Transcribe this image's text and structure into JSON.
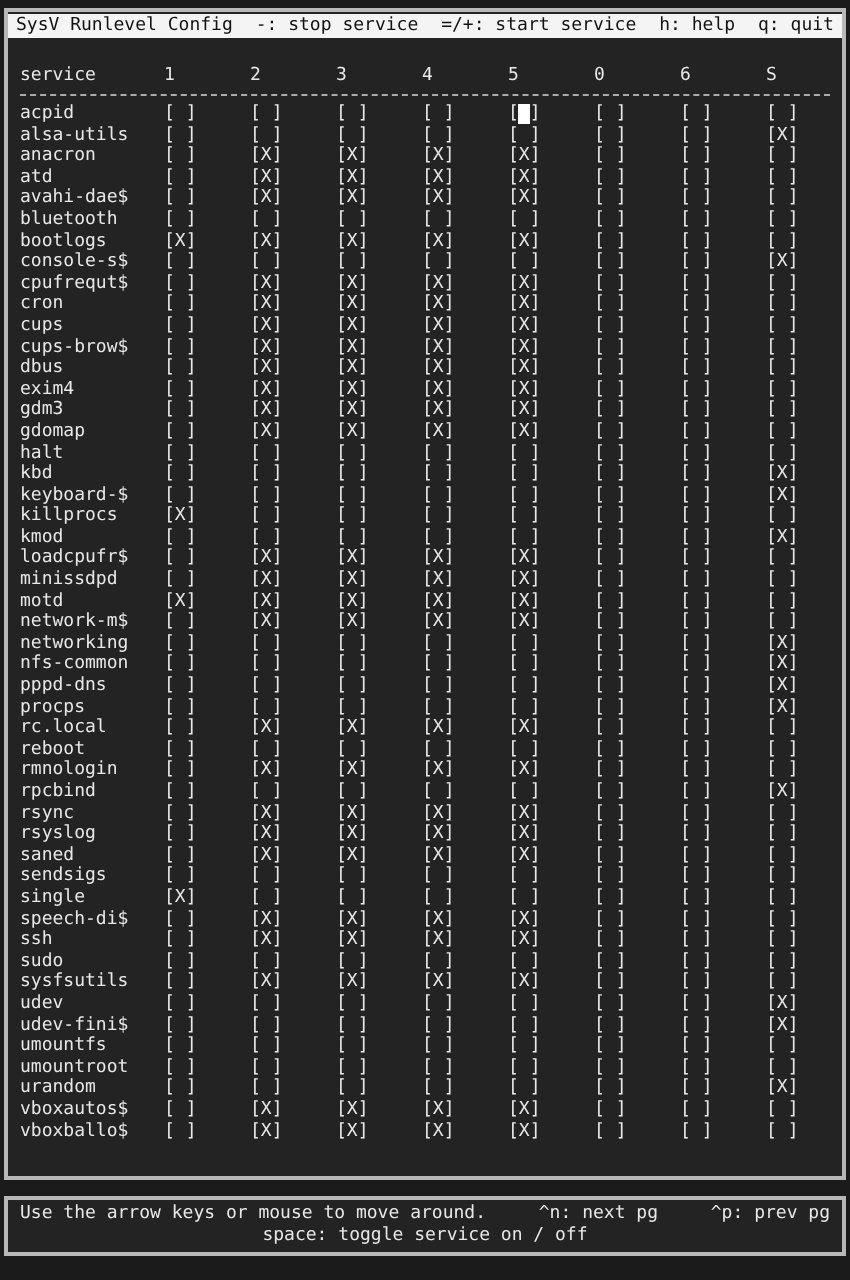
{
  "title_bar": {
    "title": "SysV Runlevel Config",
    "hints": [
      "-: stop service",
      "=/+: start service",
      "h: help",
      "q: quit"
    ]
  },
  "table": {
    "first_column": "service",
    "columns": [
      "1",
      "2",
      "3",
      "4",
      "5",
      "0",
      "6",
      "S"
    ],
    "rows": [
      {
        "service": "acpid",
        "cells": [
          {
            "text": "[ ]",
            "selected": false
          },
          {
            "text": "[ ]",
            "selected": false
          },
          {
            "text": "[ ]",
            "selected": false
          },
          {
            "text": "[ ]",
            "selected": false
          },
          {
            "text": "[ ]",
            "selected": true
          },
          {
            "text": "[ ]",
            "selected": false
          },
          {
            "text": "[ ]",
            "selected": false
          },
          {
            "text": "[ ]",
            "selected": false
          }
        ]
      },
      {
        "service": "alsa-utils",
        "cells": [
          {
            "text": "[ ]",
            "selected": false
          },
          {
            "text": "[ ]",
            "selected": false
          },
          {
            "text": "[ ]",
            "selected": false
          },
          {
            "text": "[ ]",
            "selected": false
          },
          {
            "text": "[ ]",
            "selected": false
          },
          {
            "text": "[ ]",
            "selected": false
          },
          {
            "text": "[ ]",
            "selected": false
          },
          {
            "text": "[X]",
            "selected": false
          }
        ]
      },
      {
        "service": "anacron",
        "cells": [
          {
            "text": "[ ]",
            "selected": false
          },
          {
            "text": "[X]",
            "selected": false
          },
          {
            "text": "[X]",
            "selected": false
          },
          {
            "text": "[X]",
            "selected": false
          },
          {
            "text": "[X]",
            "selected": false
          },
          {
            "text": "[ ]",
            "selected": false
          },
          {
            "text": "[ ]",
            "selected": false
          },
          {
            "text": "[ ]",
            "selected": false
          }
        ]
      },
      {
        "service": "atd",
        "cells": [
          {
            "text": "[ ]",
            "selected": false
          },
          {
            "text": "[X]",
            "selected": false
          },
          {
            "text": "[X]",
            "selected": false
          },
          {
            "text": "[X]",
            "selected": false
          },
          {
            "text": "[X]",
            "selected": false
          },
          {
            "text": "[ ]",
            "selected": false
          },
          {
            "text": "[ ]",
            "selected": false
          },
          {
            "text": "[ ]",
            "selected": false
          }
        ]
      },
      {
        "service": "avahi-dae$",
        "cells": [
          {
            "text": "[ ]",
            "selected": false
          },
          {
            "text": "[X]",
            "selected": false
          },
          {
            "text": "[X]",
            "selected": false
          },
          {
            "text": "[X]",
            "selected": false
          },
          {
            "text": "[X]",
            "selected": false
          },
          {
            "text": "[ ]",
            "selected": false
          },
          {
            "text": "[ ]",
            "selected": false
          },
          {
            "text": "[ ]",
            "selected": false
          }
        ]
      },
      {
        "service": "bluetooth",
        "cells": [
          {
            "text": "[ ]",
            "selected": false
          },
          {
            "text": "[ ]",
            "selected": false
          },
          {
            "text": "[ ]",
            "selected": false
          },
          {
            "text": "[ ]",
            "selected": false
          },
          {
            "text": "[ ]",
            "selected": false
          },
          {
            "text": "[ ]",
            "selected": false
          },
          {
            "text": "[ ]",
            "selected": false
          },
          {
            "text": "[ ]",
            "selected": false
          }
        ]
      },
      {
        "service": "bootlogs",
        "cells": [
          {
            "text": "[X]",
            "selected": false
          },
          {
            "text": "[X]",
            "selected": false
          },
          {
            "text": "[X]",
            "selected": false
          },
          {
            "text": "[X]",
            "selected": false
          },
          {
            "text": "[X]",
            "selected": false
          },
          {
            "text": "[ ]",
            "selected": false
          },
          {
            "text": "[ ]",
            "selected": false
          },
          {
            "text": "[ ]",
            "selected": false
          }
        ]
      },
      {
        "service": "console-s$",
        "cells": [
          {
            "text": "[ ]",
            "selected": false
          },
          {
            "text": "[ ]",
            "selected": false
          },
          {
            "text": "[ ]",
            "selected": false
          },
          {
            "text": "[ ]",
            "selected": false
          },
          {
            "text": "[ ]",
            "selected": false
          },
          {
            "text": "[ ]",
            "selected": false
          },
          {
            "text": "[ ]",
            "selected": false
          },
          {
            "text": "[X]",
            "selected": false
          }
        ]
      },
      {
        "service": "cpufrequt$",
        "cells": [
          {
            "text": "[ ]",
            "selected": false
          },
          {
            "text": "[X]",
            "selected": false
          },
          {
            "text": "[X]",
            "selected": false
          },
          {
            "text": "[X]",
            "selected": false
          },
          {
            "text": "[X]",
            "selected": false
          },
          {
            "text": "[ ]",
            "selected": false
          },
          {
            "text": "[ ]",
            "selected": false
          },
          {
            "text": "[ ]",
            "selected": false
          }
        ]
      },
      {
        "service": "cron",
        "cells": [
          {
            "text": "[ ]",
            "selected": false
          },
          {
            "text": "[X]",
            "selected": false
          },
          {
            "text": "[X]",
            "selected": false
          },
          {
            "text": "[X]",
            "selected": false
          },
          {
            "text": "[X]",
            "selected": false
          },
          {
            "text": "[ ]",
            "selected": false
          },
          {
            "text": "[ ]",
            "selected": false
          },
          {
            "text": "[ ]",
            "selected": false
          }
        ]
      },
      {
        "service": "cups",
        "cells": [
          {
            "text": "[ ]",
            "selected": false
          },
          {
            "text": "[X]",
            "selected": false
          },
          {
            "text": "[X]",
            "selected": false
          },
          {
            "text": "[X]",
            "selected": false
          },
          {
            "text": "[X]",
            "selected": false
          },
          {
            "text": "[ ]",
            "selected": false
          },
          {
            "text": "[ ]",
            "selected": false
          },
          {
            "text": "[ ]",
            "selected": false
          }
        ]
      },
      {
        "service": "cups-brow$",
        "cells": [
          {
            "text": "[ ]",
            "selected": false
          },
          {
            "text": "[X]",
            "selected": false
          },
          {
            "text": "[X]",
            "selected": false
          },
          {
            "text": "[X]",
            "selected": false
          },
          {
            "text": "[X]",
            "selected": false
          },
          {
            "text": "[ ]",
            "selected": false
          },
          {
            "text": "[ ]",
            "selected": false
          },
          {
            "text": "[ ]",
            "selected": false
          }
        ]
      },
      {
        "service": "dbus",
        "cells": [
          {
            "text": "[ ]",
            "selected": false
          },
          {
            "text": "[X]",
            "selected": false
          },
          {
            "text": "[X]",
            "selected": false
          },
          {
            "text": "[X]",
            "selected": false
          },
          {
            "text": "[X]",
            "selected": false
          },
          {
            "text": "[ ]",
            "selected": false
          },
          {
            "text": "[ ]",
            "selected": false
          },
          {
            "text": "[ ]",
            "selected": false
          }
        ]
      },
      {
        "service": "exim4",
        "cells": [
          {
            "text": "[ ]",
            "selected": false
          },
          {
            "text": "[X]",
            "selected": false
          },
          {
            "text": "[X]",
            "selected": false
          },
          {
            "text": "[X]",
            "selected": false
          },
          {
            "text": "[X]",
            "selected": false
          },
          {
            "text": "[ ]",
            "selected": false
          },
          {
            "text": "[ ]",
            "selected": false
          },
          {
            "text": "[ ]",
            "selected": false
          }
        ]
      },
      {
        "service": "gdm3",
        "cells": [
          {
            "text": "[ ]",
            "selected": false
          },
          {
            "text": "[X]",
            "selected": false
          },
          {
            "text": "[X]",
            "selected": false
          },
          {
            "text": "[X]",
            "selected": false
          },
          {
            "text": "[X]",
            "selected": false
          },
          {
            "text": "[ ]",
            "selected": false
          },
          {
            "text": "[ ]",
            "selected": false
          },
          {
            "text": "[ ]",
            "selected": false
          }
        ]
      },
      {
        "service": "gdomap",
        "cells": [
          {
            "text": "[ ]",
            "selected": false
          },
          {
            "text": "[X]",
            "selected": false
          },
          {
            "text": "[X]",
            "selected": false
          },
          {
            "text": "[X]",
            "selected": false
          },
          {
            "text": "[X]",
            "selected": false
          },
          {
            "text": "[ ]",
            "selected": false
          },
          {
            "text": "[ ]",
            "selected": false
          },
          {
            "text": "[ ]",
            "selected": false
          }
        ]
      },
      {
        "service": "halt",
        "cells": [
          {
            "text": "[ ]",
            "selected": false
          },
          {
            "text": "[ ]",
            "selected": false
          },
          {
            "text": "[ ]",
            "selected": false
          },
          {
            "text": "[ ]",
            "selected": false
          },
          {
            "text": "[ ]",
            "selected": false
          },
          {
            "text": "[ ]",
            "selected": false
          },
          {
            "text": "[ ]",
            "selected": false
          },
          {
            "text": "[ ]",
            "selected": false
          }
        ]
      },
      {
        "service": "kbd",
        "cells": [
          {
            "text": "[ ]",
            "selected": false
          },
          {
            "text": "[ ]",
            "selected": false
          },
          {
            "text": "[ ]",
            "selected": false
          },
          {
            "text": "[ ]",
            "selected": false
          },
          {
            "text": "[ ]",
            "selected": false
          },
          {
            "text": "[ ]",
            "selected": false
          },
          {
            "text": "[ ]",
            "selected": false
          },
          {
            "text": "[X]",
            "selected": false
          }
        ]
      },
      {
        "service": "keyboard-$",
        "cells": [
          {
            "text": "[ ]",
            "selected": false
          },
          {
            "text": "[ ]",
            "selected": false
          },
          {
            "text": "[ ]",
            "selected": false
          },
          {
            "text": "[ ]",
            "selected": false
          },
          {
            "text": "[ ]",
            "selected": false
          },
          {
            "text": "[ ]",
            "selected": false
          },
          {
            "text": "[ ]",
            "selected": false
          },
          {
            "text": "[X]",
            "selected": false
          }
        ]
      },
      {
        "service": "killprocs",
        "cells": [
          {
            "text": "[X]",
            "selected": false
          },
          {
            "text": "[ ]",
            "selected": false
          },
          {
            "text": "[ ]",
            "selected": false
          },
          {
            "text": "[ ]",
            "selected": false
          },
          {
            "text": "[ ]",
            "selected": false
          },
          {
            "text": "[ ]",
            "selected": false
          },
          {
            "text": "[ ]",
            "selected": false
          },
          {
            "text": "[ ]",
            "selected": false
          }
        ]
      },
      {
        "service": "kmod",
        "cells": [
          {
            "text": "[ ]",
            "selected": false
          },
          {
            "text": "[ ]",
            "selected": false
          },
          {
            "text": "[ ]",
            "selected": false
          },
          {
            "text": "[ ]",
            "selected": false
          },
          {
            "text": "[ ]",
            "selected": false
          },
          {
            "text": "[ ]",
            "selected": false
          },
          {
            "text": "[ ]",
            "selected": false
          },
          {
            "text": "[X]",
            "selected": false
          }
        ]
      },
      {
        "service": "loadcpufr$",
        "cells": [
          {
            "text": "[ ]",
            "selected": false
          },
          {
            "text": "[X]",
            "selected": false
          },
          {
            "text": "[X]",
            "selected": false
          },
          {
            "text": "[X]",
            "selected": false
          },
          {
            "text": "[X]",
            "selected": false
          },
          {
            "text": "[ ]",
            "selected": false
          },
          {
            "text": "[ ]",
            "selected": false
          },
          {
            "text": "[ ]",
            "selected": false
          }
        ]
      },
      {
        "service": "minissdpd",
        "cells": [
          {
            "text": "[ ]",
            "selected": false
          },
          {
            "text": "[X]",
            "selected": false
          },
          {
            "text": "[X]",
            "selected": false
          },
          {
            "text": "[X]",
            "selected": false
          },
          {
            "text": "[X]",
            "selected": false
          },
          {
            "text": "[ ]",
            "selected": false
          },
          {
            "text": "[ ]",
            "selected": false
          },
          {
            "text": "[ ]",
            "selected": false
          }
        ]
      },
      {
        "service": "motd",
        "cells": [
          {
            "text": "[X]",
            "selected": false
          },
          {
            "text": "[X]",
            "selected": false
          },
          {
            "text": "[X]",
            "selected": false
          },
          {
            "text": "[X]",
            "selected": false
          },
          {
            "text": "[X]",
            "selected": false
          },
          {
            "text": "[ ]",
            "selected": false
          },
          {
            "text": "[ ]",
            "selected": false
          },
          {
            "text": "[ ]",
            "selected": false
          }
        ]
      },
      {
        "service": "network-m$",
        "cells": [
          {
            "text": "[ ]",
            "selected": false
          },
          {
            "text": "[X]",
            "selected": false
          },
          {
            "text": "[X]",
            "selected": false
          },
          {
            "text": "[X]",
            "selected": false
          },
          {
            "text": "[X]",
            "selected": false
          },
          {
            "text": "[ ]",
            "selected": false
          },
          {
            "text": "[ ]",
            "selected": false
          },
          {
            "text": "[ ]",
            "selected": false
          }
        ]
      },
      {
        "service": "networking",
        "cells": [
          {
            "text": "[ ]",
            "selected": false
          },
          {
            "text": "[ ]",
            "selected": false
          },
          {
            "text": "[ ]",
            "selected": false
          },
          {
            "text": "[ ]",
            "selected": false
          },
          {
            "text": "[ ]",
            "selected": false
          },
          {
            "text": "[ ]",
            "selected": false
          },
          {
            "text": "[ ]",
            "selected": false
          },
          {
            "text": "[X]",
            "selected": false
          }
        ]
      },
      {
        "service": "nfs-common",
        "cells": [
          {
            "text": "[ ]",
            "selected": false
          },
          {
            "text": "[ ]",
            "selected": false
          },
          {
            "text": "[ ]",
            "selected": false
          },
          {
            "text": "[ ]",
            "selected": false
          },
          {
            "text": "[ ]",
            "selected": false
          },
          {
            "text": "[ ]",
            "selected": false
          },
          {
            "text": "[ ]",
            "selected": false
          },
          {
            "text": "[X]",
            "selected": false
          }
        ]
      },
      {
        "service": "pppd-dns",
        "cells": [
          {
            "text": "[ ]",
            "selected": false
          },
          {
            "text": "[ ]",
            "selected": false
          },
          {
            "text": "[ ]",
            "selected": false
          },
          {
            "text": "[ ]",
            "selected": false
          },
          {
            "text": "[ ]",
            "selected": false
          },
          {
            "text": "[ ]",
            "selected": false
          },
          {
            "text": "[ ]",
            "selected": false
          },
          {
            "text": "[X]",
            "selected": false
          }
        ]
      },
      {
        "service": "procps",
        "cells": [
          {
            "text": "[ ]",
            "selected": false
          },
          {
            "text": "[ ]",
            "selected": false
          },
          {
            "text": "[ ]",
            "selected": false
          },
          {
            "text": "[ ]",
            "selected": false
          },
          {
            "text": "[ ]",
            "selected": false
          },
          {
            "text": "[ ]",
            "selected": false
          },
          {
            "text": "[ ]",
            "selected": false
          },
          {
            "text": "[X]",
            "selected": false
          }
        ]
      },
      {
        "service": "rc.local",
        "cells": [
          {
            "text": "[ ]",
            "selected": false
          },
          {
            "text": "[X]",
            "selected": false
          },
          {
            "text": "[X]",
            "selected": false
          },
          {
            "text": "[X]",
            "selected": false
          },
          {
            "text": "[X]",
            "selected": false
          },
          {
            "text": "[ ]",
            "selected": false
          },
          {
            "text": "[ ]",
            "selected": false
          },
          {
            "text": "[ ]",
            "selected": false
          }
        ]
      },
      {
        "service": "reboot",
        "cells": [
          {
            "text": "[ ]",
            "selected": false
          },
          {
            "text": "[ ]",
            "selected": false
          },
          {
            "text": "[ ]",
            "selected": false
          },
          {
            "text": "[ ]",
            "selected": false
          },
          {
            "text": "[ ]",
            "selected": false
          },
          {
            "text": "[ ]",
            "selected": false
          },
          {
            "text": "[ ]",
            "selected": false
          },
          {
            "text": "[ ]",
            "selected": false
          }
        ]
      },
      {
        "service": "rmnologin",
        "cells": [
          {
            "text": "[ ]",
            "selected": false
          },
          {
            "text": "[X]",
            "selected": false
          },
          {
            "text": "[X]",
            "selected": false
          },
          {
            "text": "[X]",
            "selected": false
          },
          {
            "text": "[X]",
            "selected": false
          },
          {
            "text": "[ ]",
            "selected": false
          },
          {
            "text": "[ ]",
            "selected": false
          },
          {
            "text": "[ ]",
            "selected": false
          }
        ]
      },
      {
        "service": "rpcbind",
        "cells": [
          {
            "text": "[ ]",
            "selected": false
          },
          {
            "text": "[ ]",
            "selected": false
          },
          {
            "text": "[ ]",
            "selected": false
          },
          {
            "text": "[ ]",
            "selected": false
          },
          {
            "text": "[ ]",
            "selected": false
          },
          {
            "text": "[ ]",
            "selected": false
          },
          {
            "text": "[ ]",
            "selected": false
          },
          {
            "text": "[X]",
            "selected": false
          }
        ]
      },
      {
        "service": "rsync",
        "cells": [
          {
            "text": "[ ]",
            "selected": false
          },
          {
            "text": "[X]",
            "selected": false
          },
          {
            "text": "[X]",
            "selected": false
          },
          {
            "text": "[X]",
            "selected": false
          },
          {
            "text": "[X]",
            "selected": false
          },
          {
            "text": "[ ]",
            "selected": false
          },
          {
            "text": "[ ]",
            "selected": false
          },
          {
            "text": "[ ]",
            "selected": false
          }
        ]
      },
      {
        "service": "rsyslog",
        "cells": [
          {
            "text": "[ ]",
            "selected": false
          },
          {
            "text": "[X]",
            "selected": false
          },
          {
            "text": "[X]",
            "selected": false
          },
          {
            "text": "[X]",
            "selected": false
          },
          {
            "text": "[X]",
            "selected": false
          },
          {
            "text": "[ ]",
            "selected": false
          },
          {
            "text": "[ ]",
            "selected": false
          },
          {
            "text": "[ ]",
            "selected": false
          }
        ]
      },
      {
        "service": "saned",
        "cells": [
          {
            "text": "[ ]",
            "selected": false
          },
          {
            "text": "[X]",
            "selected": false
          },
          {
            "text": "[X]",
            "selected": false
          },
          {
            "text": "[X]",
            "selected": false
          },
          {
            "text": "[X]",
            "selected": false
          },
          {
            "text": "[ ]",
            "selected": false
          },
          {
            "text": "[ ]",
            "selected": false
          },
          {
            "text": "[ ]",
            "selected": false
          }
        ]
      },
      {
        "service": "sendsigs",
        "cells": [
          {
            "text": "[ ]",
            "selected": false
          },
          {
            "text": "[ ]",
            "selected": false
          },
          {
            "text": "[ ]",
            "selected": false
          },
          {
            "text": "[ ]",
            "selected": false
          },
          {
            "text": "[ ]",
            "selected": false
          },
          {
            "text": "[ ]",
            "selected": false
          },
          {
            "text": "[ ]",
            "selected": false
          },
          {
            "text": "[ ]",
            "selected": false
          }
        ]
      },
      {
        "service": "single",
        "cells": [
          {
            "text": "[X]",
            "selected": false
          },
          {
            "text": "[ ]",
            "selected": false
          },
          {
            "text": "[ ]",
            "selected": false
          },
          {
            "text": "[ ]",
            "selected": false
          },
          {
            "text": "[ ]",
            "selected": false
          },
          {
            "text": "[ ]",
            "selected": false
          },
          {
            "text": "[ ]",
            "selected": false
          },
          {
            "text": "[ ]",
            "selected": false
          }
        ]
      },
      {
        "service": "speech-di$",
        "cells": [
          {
            "text": "[ ]",
            "selected": false
          },
          {
            "text": "[X]",
            "selected": false
          },
          {
            "text": "[X]",
            "selected": false
          },
          {
            "text": "[X]",
            "selected": false
          },
          {
            "text": "[X]",
            "selected": false
          },
          {
            "text": "[ ]",
            "selected": false
          },
          {
            "text": "[ ]",
            "selected": false
          },
          {
            "text": "[ ]",
            "selected": false
          }
        ]
      },
      {
        "service": "ssh",
        "cells": [
          {
            "text": "[ ]",
            "selected": false
          },
          {
            "text": "[X]",
            "selected": false
          },
          {
            "text": "[X]",
            "selected": false
          },
          {
            "text": "[X]",
            "selected": false
          },
          {
            "text": "[X]",
            "selected": false
          },
          {
            "text": "[ ]",
            "selected": false
          },
          {
            "text": "[ ]",
            "selected": false
          },
          {
            "text": "[ ]",
            "selected": false
          }
        ]
      },
      {
        "service": "sudo",
        "cells": [
          {
            "text": "[ ]",
            "selected": false
          },
          {
            "text": "[ ]",
            "selected": false
          },
          {
            "text": "[ ]",
            "selected": false
          },
          {
            "text": "[ ]",
            "selected": false
          },
          {
            "text": "[ ]",
            "selected": false
          },
          {
            "text": "[ ]",
            "selected": false
          },
          {
            "text": "[ ]",
            "selected": false
          },
          {
            "text": "[ ]",
            "selected": false
          }
        ]
      },
      {
        "service": "sysfsutils",
        "cells": [
          {
            "text": "[ ]",
            "selected": false
          },
          {
            "text": "[X]",
            "selected": false
          },
          {
            "text": "[X]",
            "selected": false
          },
          {
            "text": "[X]",
            "selected": false
          },
          {
            "text": "[X]",
            "selected": false
          },
          {
            "text": "[ ]",
            "selected": false
          },
          {
            "text": "[ ]",
            "selected": false
          },
          {
            "text": "[ ]",
            "selected": false
          }
        ]
      },
      {
        "service": "udev",
        "cells": [
          {
            "text": "[ ]",
            "selected": false
          },
          {
            "text": "[ ]",
            "selected": false
          },
          {
            "text": "[ ]",
            "selected": false
          },
          {
            "text": "[ ]",
            "selected": false
          },
          {
            "text": "[ ]",
            "selected": false
          },
          {
            "text": "[ ]",
            "selected": false
          },
          {
            "text": "[ ]",
            "selected": false
          },
          {
            "text": "[X]",
            "selected": false
          }
        ]
      },
      {
        "service": "udev-fini$",
        "cells": [
          {
            "text": "[ ]",
            "selected": false
          },
          {
            "text": "[ ]",
            "selected": false
          },
          {
            "text": "[ ]",
            "selected": false
          },
          {
            "text": "[ ]",
            "selected": false
          },
          {
            "text": "[ ]",
            "selected": false
          },
          {
            "text": "[ ]",
            "selected": false
          },
          {
            "text": "[ ]",
            "selected": false
          },
          {
            "text": "[X]",
            "selected": false
          }
        ]
      },
      {
        "service": "umountfs",
        "cells": [
          {
            "text": "[ ]",
            "selected": false
          },
          {
            "text": "[ ]",
            "selected": false
          },
          {
            "text": "[ ]",
            "selected": false
          },
          {
            "text": "[ ]",
            "selected": false
          },
          {
            "text": "[ ]",
            "selected": false
          },
          {
            "text": "[ ]",
            "selected": false
          },
          {
            "text": "[ ]",
            "selected": false
          },
          {
            "text": "[ ]",
            "selected": false
          }
        ]
      },
      {
        "service": "umountroot",
        "cells": [
          {
            "text": "[ ]",
            "selected": false
          },
          {
            "text": "[ ]",
            "selected": false
          },
          {
            "text": "[ ]",
            "selected": false
          },
          {
            "text": "[ ]",
            "selected": false
          },
          {
            "text": "[ ]",
            "selected": false
          },
          {
            "text": "[ ]",
            "selected": false
          },
          {
            "text": "[ ]",
            "selected": false
          },
          {
            "text": "[ ]",
            "selected": false
          }
        ]
      },
      {
        "service": "urandom",
        "cells": [
          {
            "text": "[ ]",
            "selected": false
          },
          {
            "text": "[ ]",
            "selected": false
          },
          {
            "text": "[ ]",
            "selected": false
          },
          {
            "text": "[ ]",
            "selected": false
          },
          {
            "text": "[ ]",
            "selected": false
          },
          {
            "text": "[ ]",
            "selected": false
          },
          {
            "text": "[ ]",
            "selected": false
          },
          {
            "text": "[X]",
            "selected": false
          }
        ]
      },
      {
        "service": "vboxautos$",
        "cells": [
          {
            "text": "[ ]",
            "selected": false
          },
          {
            "text": "[X]",
            "selected": false
          },
          {
            "text": "[X]",
            "selected": false
          },
          {
            "text": "[X]",
            "selected": false
          },
          {
            "text": "[X]",
            "selected": false
          },
          {
            "text": "[ ]",
            "selected": false
          },
          {
            "text": "[ ]",
            "selected": false
          },
          {
            "text": "[ ]",
            "selected": false
          }
        ]
      },
      {
        "service": "vboxballo$",
        "cells": [
          {
            "text": "[ ]",
            "selected": false
          },
          {
            "text": "[X]",
            "selected": false
          },
          {
            "text": "[X]",
            "selected": false
          },
          {
            "text": "[X]",
            "selected": false
          },
          {
            "text": "[X]",
            "selected": false
          },
          {
            "text": "[ ]",
            "selected": false
          },
          {
            "text": "[ ]",
            "selected": false
          },
          {
            "text": "[ ]",
            "selected": false
          }
        ]
      }
    ]
  },
  "footer": {
    "line_1": [
      "Use the arrow keys or mouse to move around.",
      "^n: next pg",
      "^p: prev pg"
    ],
    "line_2": "space: toggle service on / off"
  }
}
